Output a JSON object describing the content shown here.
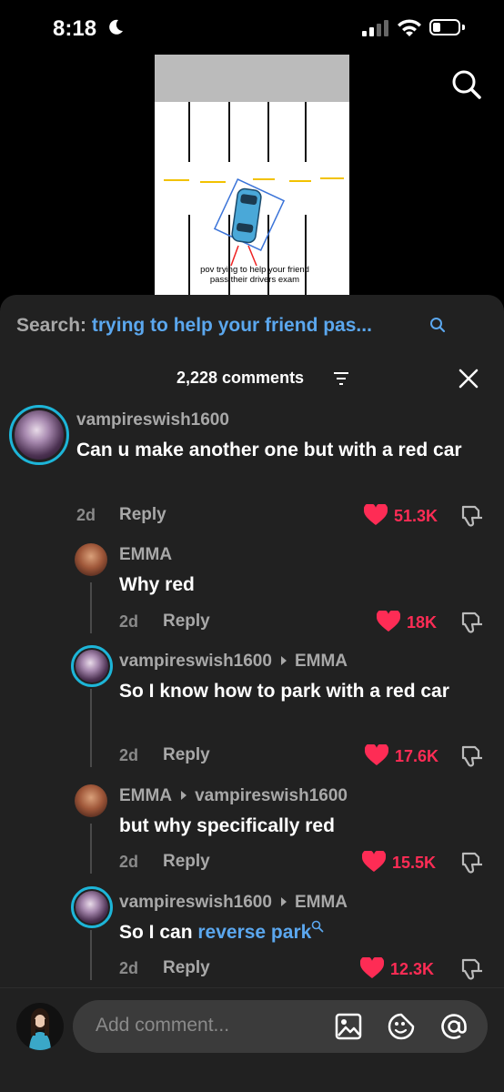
{
  "status": {
    "time": "8:18"
  },
  "video": {
    "caption": "pov trying to help your friend pass their drivers exam"
  },
  "search": {
    "label": "Search:",
    "query": "trying to help your friend pas..."
  },
  "header": {
    "count": "2,228 comments"
  },
  "comments": [
    {
      "user": "vampireswish1600",
      "text": "Can u make another one but with a red car",
      "age": "2d",
      "reply": "Reply",
      "likes": "51.3K"
    },
    {
      "user": "EMMA",
      "text": "Why red",
      "age": "2d",
      "reply": "Reply",
      "likes": "18K"
    },
    {
      "user": "vampireswish1600",
      "to": "EMMA",
      "text": "So I know how to park with a red car",
      "age": "2d",
      "reply": "Reply",
      "likes": "17.6K"
    },
    {
      "user": "EMMA",
      "to": "vampireswish1600",
      "text": "but why specifically red",
      "age": "2d",
      "reply": "Reply",
      "likes": "15.5K"
    },
    {
      "user": "vampireswish1600",
      "to": "EMMA",
      "text_prefix": "So I can ",
      "text_link": "reverse park",
      "age": "2d",
      "reply": "Reply",
      "likes": "12.3K"
    }
  ],
  "compose": {
    "placeholder": "Add comment..."
  },
  "colors": {
    "accent_like": "#fe2c55",
    "link": "#5ba7ee",
    "ring": "#1db5d8"
  }
}
